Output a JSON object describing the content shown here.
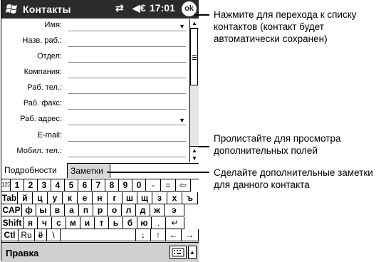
{
  "titlebar": {
    "app_title": "Контакты",
    "connectivity_icon": "connectivity-icon",
    "volume_icon": "speaker-icon",
    "time": "17:01",
    "ok_label": "ok"
  },
  "form": {
    "fields": [
      {
        "label": "Имя:",
        "has_dropdown": true
      },
      {
        "label": "Назв. раб.:",
        "has_dropdown": false
      },
      {
        "label": "Отдел:",
        "has_dropdown": false
      },
      {
        "label": "Компания:",
        "has_dropdown": false
      },
      {
        "label": "Раб. тел.:",
        "has_dropdown": false
      },
      {
        "label": "Раб. факс:",
        "has_dropdown": false
      },
      {
        "label": "Раб. адрес:",
        "has_dropdown": true
      },
      {
        "label": "E-mail:",
        "has_dropdown": false
      },
      {
        "label": "Мобил. тел.:",
        "has_dropdown": false
      }
    ]
  },
  "tabs": [
    {
      "label": "Подробности",
      "active": true
    },
    {
      "label": "Заметки",
      "active": false
    }
  ],
  "keyboard": {
    "rows": [
      [
        "123",
        "1",
        "2",
        "3",
        "4",
        "5",
        "6",
        "7",
        "8",
        "9",
        "0",
        "-",
        "=",
        "⇦"
      ],
      [
        "Tab",
        "й",
        "ц",
        "у",
        "к",
        "е",
        "н",
        "г",
        "ш",
        "щ",
        "з",
        "х",
        "ъ"
      ],
      [
        "CAP",
        "ф",
        "ы",
        "в",
        "а",
        "п",
        "р",
        "о",
        "л",
        "д",
        "ж",
        "э"
      ],
      [
        "Shift",
        "я",
        "ч",
        "с",
        "м",
        "и",
        "т",
        "ь",
        "б",
        "ю",
        ".",
        "↵"
      ],
      [
        "Ctl",
        "Ru",
        "ё",
        "\\",
        " ",
        "↓",
        "↑",
        "←",
        "→"
      ]
    ]
  },
  "bottombar": {
    "menu_label": "Правка",
    "sip_icon": "keyboard-icon"
  },
  "callouts": [
    {
      "text": "Нажмите для перехода к списку контактов (контакт будет автоматически сохранен)"
    },
    {
      "text": "Пролистайте для просмотра дополнительных полей"
    },
    {
      "text": "Сделайте дополнительные заметки для данного контакта"
    }
  ]
}
